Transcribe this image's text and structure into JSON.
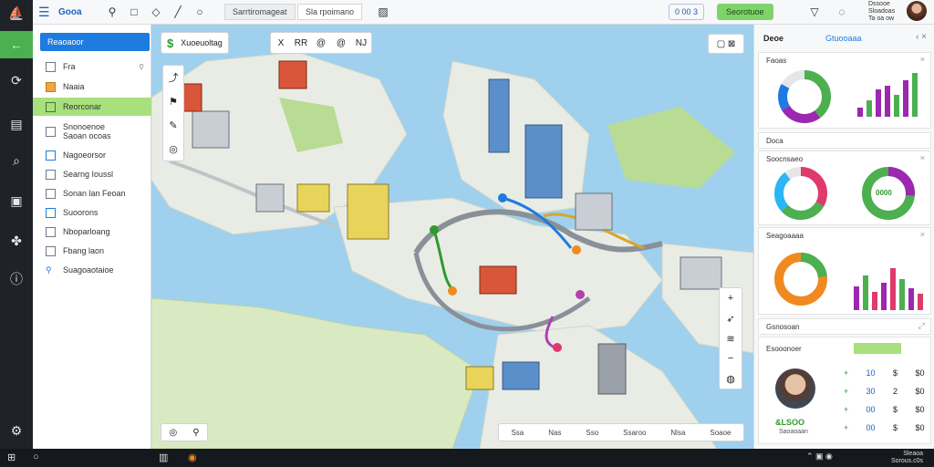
{
  "topbar": {
    "app_title": "Gooa",
    "tabs": [
      "Sarrtiromageat",
      "Sla rpoimano"
    ],
    "status_chip": "0 00 3",
    "action_button": "Seorotuoe",
    "right_labels": [
      "Dssooe",
      "Sloadoas",
      "Ta oa ow"
    ]
  },
  "sidebar_left": {
    "header": "Reaoaoor",
    "items": [
      {
        "label": "Fra",
        "icon": "layer-icon"
      },
      {
        "label": "Naaia",
        "icon": "folder-icon"
      },
      {
        "label": "Reorconar",
        "icon": "tag-icon"
      },
      {
        "label": "Snonoenoe\nSaoan ocoas",
        "icon": "doc-icon"
      },
      {
        "label": "Nagoeorsor",
        "icon": "list-icon"
      },
      {
        "label": "Searng Ioussl",
        "icon": "doc-icon"
      },
      {
        "label": "Sonan lan Feoan",
        "icon": "doc-icon"
      },
      {
        "label": "Suoorons",
        "icon": "list-icon"
      },
      {
        "label": "Nboparloang",
        "icon": "doc-icon"
      },
      {
        "label": "Fbang laon",
        "icon": "doc-icon"
      },
      {
        "label": "Suagoaotaioe",
        "icon": "pin-icon"
      }
    ]
  },
  "map": {
    "toolbar_title": "Xuoeuoltag",
    "tools": [
      "X",
      "RR",
      "@",
      "@",
      "NJ"
    ],
    "legend": [
      "Ssa",
      "Nas",
      "Sso",
      "Ssaroo",
      "Nlsa",
      "Soaoe"
    ]
  },
  "right_panel": {
    "title": "Deoe",
    "subtitle": "Gtuooaaa",
    "cards": [
      {
        "title": "Faoas",
        "type": "donut_and_bar"
      },
      {
        "title": "Doca",
        "type": "label"
      },
      {
        "title": "Soocnsaeo",
        "type": "two_donuts",
        "center_label": "0000"
      },
      {
        "title": "Seagoaaaa",
        "type": "donut_and_bar"
      },
      {
        "title": "Gsnosoan",
        "type": "profile"
      }
    ],
    "profile": {
      "section": "Esooonoer",
      "name": "&LSOO",
      "sub": "Saoaoaan",
      "stats": [
        [
          "+",
          "10",
          "$",
          "$0"
        ],
        [
          "+",
          "30",
          "2",
          "$0"
        ],
        [
          "+",
          "00",
          "$",
          "$0"
        ],
        [
          "+",
          "00",
          "$",
          "$0"
        ]
      ]
    }
  },
  "taskbar": {
    "clock_line1": "Sleaoa",
    "clock_line2": "Sorous.c0s"
  },
  "colors": {
    "accent_green": "#7fd36b",
    "accent_blue": "#1e7be0",
    "water": "#9fd0ee",
    "land": "#e9ece4"
  }
}
